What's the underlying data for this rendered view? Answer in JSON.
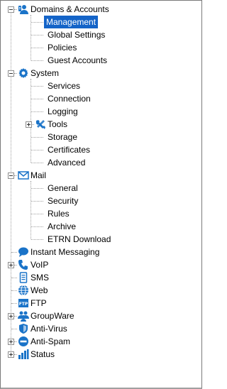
{
  "tree": {
    "domains": {
      "label": "Domains & Accounts",
      "children": [
        "Management",
        "Global Settings",
        "Policies",
        "Guest Accounts"
      ]
    },
    "system": {
      "label": "System",
      "children": [
        "Services",
        "Connection",
        "Logging",
        "Tools",
        "Storage",
        "Certificates",
        "Advanced"
      ]
    },
    "mail": {
      "label": "Mail",
      "children": [
        "General",
        "Security",
        "Rules",
        "Archive",
        "ETRN Download"
      ]
    },
    "instant_messaging": {
      "label": "Instant Messaging"
    },
    "voip": {
      "label": "VoIP"
    },
    "sms": {
      "label": "SMS"
    },
    "web": {
      "label": "Web"
    },
    "ftp": {
      "label": "FTP"
    },
    "groupware": {
      "label": "GroupWare"
    },
    "antivirus": {
      "label": "Anti-Virus"
    },
    "antispam": {
      "label": "Anti-Spam"
    },
    "status": {
      "label": "Status"
    }
  },
  "selected": "Management",
  "colors": {
    "selection": "#1464c8",
    "icon_blue": "#1a73c8"
  },
  "icons": {
    "domains": "users-icon",
    "system": "gear-icon",
    "tools": "tools-icon",
    "mail": "envelope-icon",
    "instant_messaging": "chat-bubble-icon",
    "voip": "phone-icon",
    "sms": "mobile-icon",
    "web": "globe-icon",
    "ftp": "ftp-icon",
    "groupware": "group-icon",
    "antivirus": "shield-icon",
    "antispam": "no-entry-icon",
    "status": "bar-chart-icon"
  }
}
